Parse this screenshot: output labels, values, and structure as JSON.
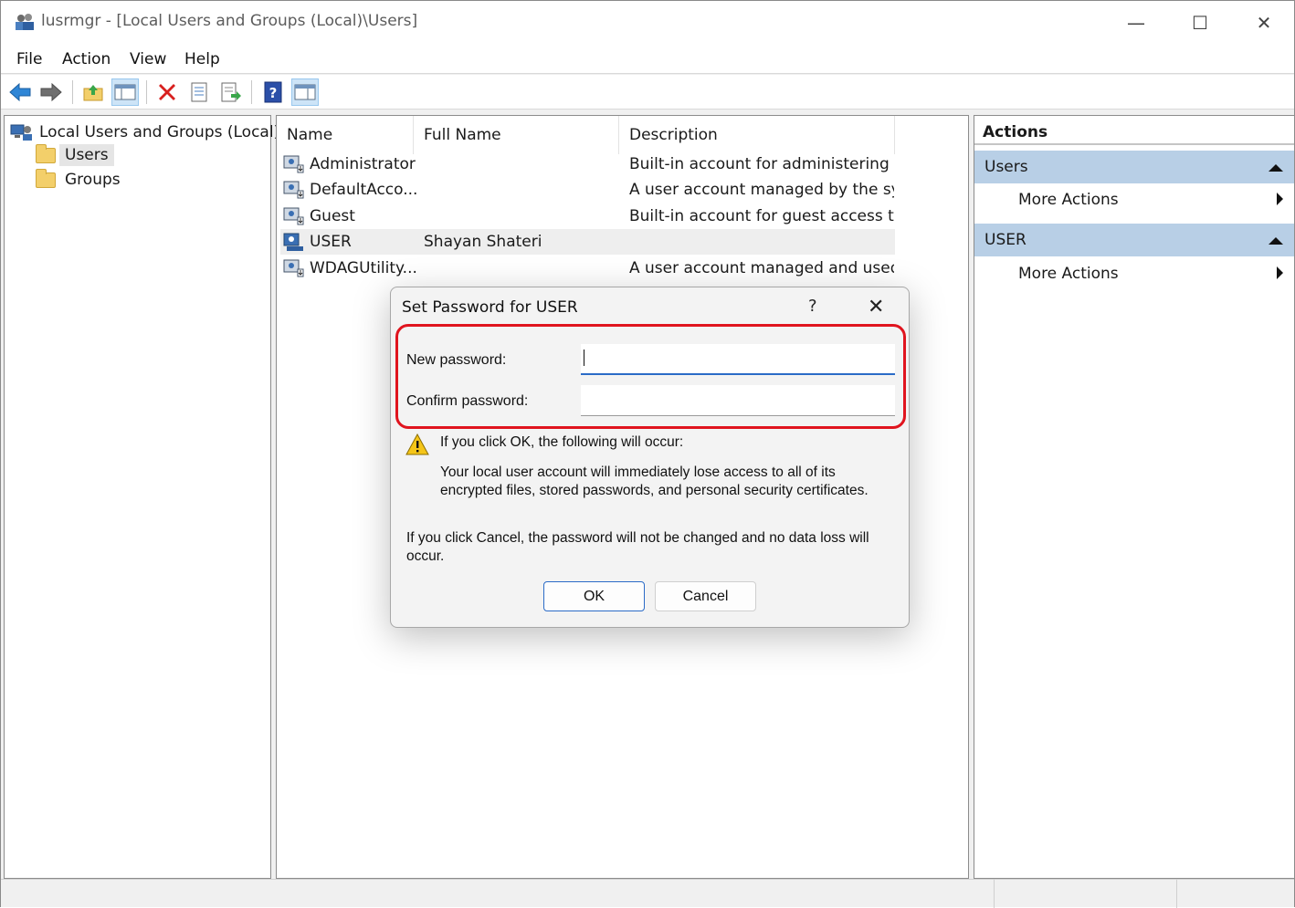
{
  "window": {
    "title": "lusrmgr - [Local Users and Groups (Local)\\Users]",
    "minimize": "—",
    "maximize": "☐",
    "close": "✕"
  },
  "menu": [
    "File",
    "Action",
    "View",
    "Help"
  ],
  "tree": {
    "root": "Local Users and Groups (Local)",
    "children": [
      "Users",
      "Groups"
    ],
    "selected": "Users"
  },
  "list": {
    "columns": [
      "Name",
      "Full Name",
      "Description"
    ],
    "rows": [
      {
        "name": "Administrator",
        "full_name": "",
        "description": "Built-in account for administering ..."
      },
      {
        "name": "DefaultAcco...",
        "full_name": "",
        "description": "A user account managed by the sy..."
      },
      {
        "name": "Guest",
        "full_name": "",
        "description": "Built-in account for guest access t..."
      },
      {
        "name": "USER",
        "full_name": "Shayan Shateri",
        "description": ""
      },
      {
        "name": "WDAGUtility...",
        "full_name": "",
        "description": "A user account managed and used..."
      }
    ]
  },
  "actions": {
    "title": "Actions",
    "groups": [
      {
        "label": "Users",
        "item": "More Actions"
      },
      {
        "label": "USER",
        "item": "More Actions"
      }
    ]
  },
  "dialog": {
    "title": "Set Password for USER",
    "help": "?",
    "close": "✕",
    "new_password_label": "New password:",
    "confirm_password_label": "Confirm password:",
    "new_password_value": "",
    "confirm_password_value": "",
    "warning_heading": "If you click OK, the following will occur:",
    "warning_body_1": "Your local user account will immediately lose access to all of its",
    "warning_body_2": "encrypted files, stored passwords, and personal security certificates.",
    "cancel_note_1": "If you click Cancel, the password will not be changed and no data loss will",
    "cancel_note_2": "occur.",
    "ok_label": "OK",
    "cancel_label": "Cancel"
  },
  "colors": {
    "highlight_box": "#e0141e",
    "focus_accent": "#2b6bc7",
    "actions_group_bg": "#b8cfe6"
  }
}
